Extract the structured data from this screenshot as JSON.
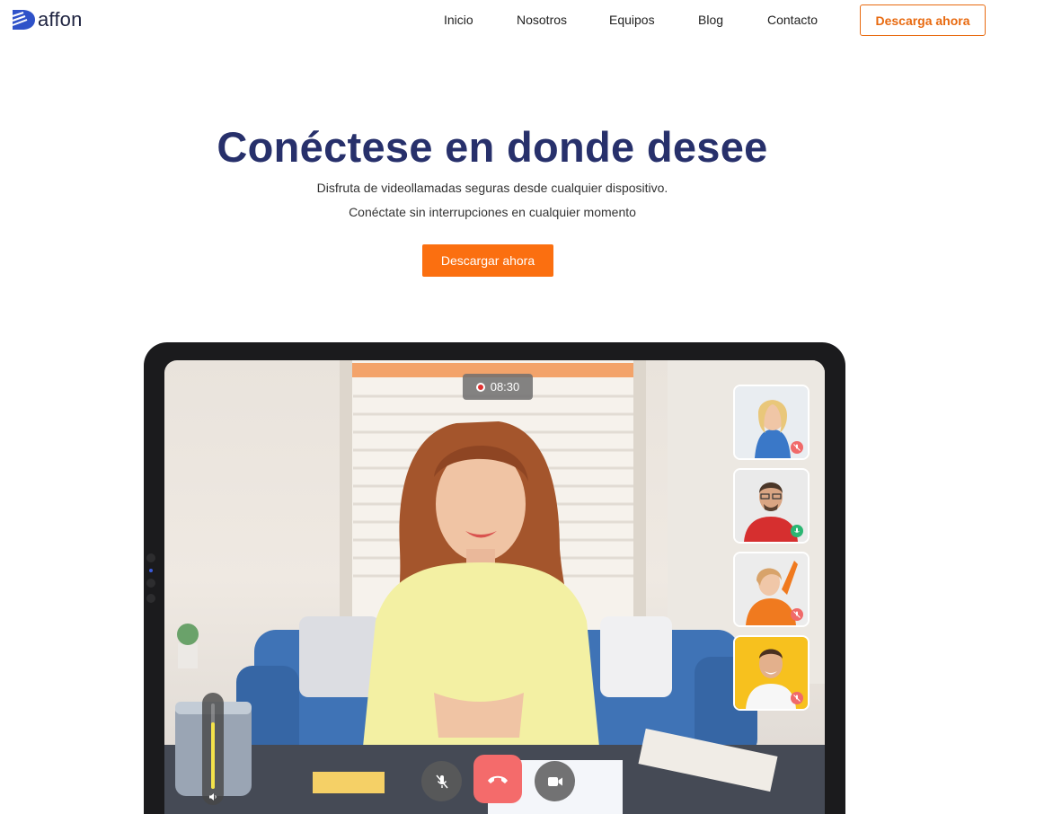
{
  "brand": {
    "logo_letter": "D",
    "name": "affon",
    "accent": "#fb6f10",
    "title_color": "#27306b"
  },
  "nav": {
    "items": [
      "Inicio",
      "Nosotros",
      "Equipos",
      "Blog",
      "Contacto"
    ],
    "cta": "Descarga ahora"
  },
  "hero": {
    "title": "Conéctese en donde desee",
    "subtitle_1": "Disfruta de videollamadas seguras desde cualquier dispositivo.",
    "subtitle_2": "Conéctate sin interrupciones en cualquier momento",
    "cta": "Descargar ahora"
  },
  "call": {
    "timer": "08:30",
    "volume_level": 0.78,
    "participants": [
      {
        "icon": "participant-1-thumbnail",
        "mic": "muted"
      },
      {
        "icon": "participant-2-thumbnail",
        "mic": "active"
      },
      {
        "icon": "participant-3-thumbnail",
        "mic": "muted"
      },
      {
        "icon": "participant-4-thumbnail",
        "mic": "muted"
      }
    ],
    "controls": [
      "mute-mic-icon",
      "end-call-icon",
      "video-camera-icon"
    ]
  }
}
